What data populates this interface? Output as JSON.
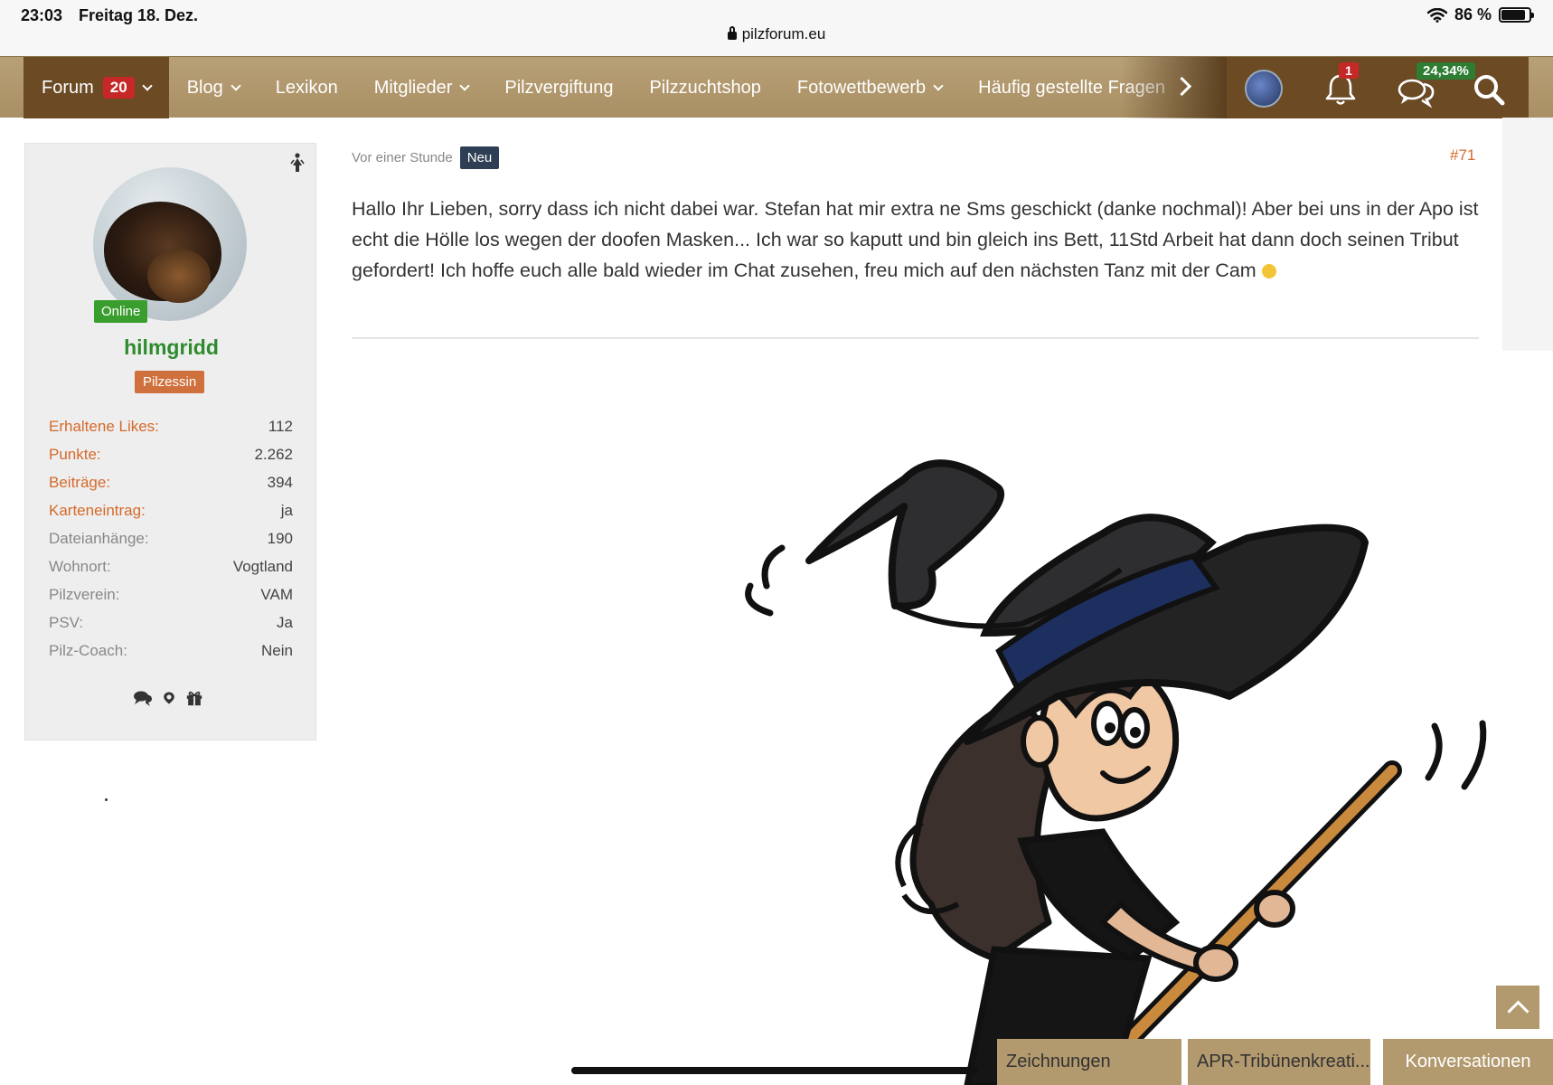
{
  "status": {
    "time": "23:03",
    "date": "Freitag 18. Dez.",
    "battery": "86 %",
    "battery_level": 0.86
  },
  "browser": {
    "url": "pilzforum.eu"
  },
  "nav": {
    "items": [
      {
        "label": "Forum",
        "badge": "20",
        "dropdown": true
      },
      {
        "label": "Blog",
        "dropdown": true
      },
      {
        "label": "Lexikon",
        "dropdown": false
      },
      {
        "label": "Mitglieder",
        "dropdown": true
      },
      {
        "label": "Pilzvergiftung",
        "dropdown": false
      },
      {
        "label": "Pilzzuchtshop",
        "dropdown": false
      },
      {
        "label": "Fotowettbewerb",
        "dropdown": true
      },
      {
        "label": "Häufig gestellte Fragen",
        "dropdown": false
      }
    ],
    "notifications_badge": "1",
    "conversations_badge": "24,34%"
  },
  "user": {
    "name": "hilmgridd",
    "online": "Online",
    "rank": "Pilzessin",
    "stats": [
      {
        "key": "Erhaltene Likes",
        "value": "112",
        "link": true
      },
      {
        "key": "Punkte",
        "value": "2.262",
        "link": true
      },
      {
        "key": "Beiträge",
        "value": "394",
        "link": true
      },
      {
        "key": "Karteneintrag",
        "value": "ja",
        "link": true
      },
      {
        "key": "Dateianhänge",
        "value": "190",
        "link": false
      },
      {
        "key": "Wohnort",
        "value": "Vogtland",
        "link": false
      },
      {
        "key": "Pilzverein",
        "value": "VAM",
        "link": false
      },
      {
        "key": "PSV",
        "value": "Ja",
        "link": false
      },
      {
        "key": "Pilz-Coach",
        "value": "Nein",
        "link": false
      }
    ]
  },
  "post": {
    "time": "Vor einer Stunde",
    "new_label": "Neu",
    "number": "#71",
    "text": "Hallo Ihr Lieben, sorry dass ich nicht dabei war. Stefan hat mir extra ne Sms geschickt (danke nochmal)! Aber bei uns in der Apo ist echt die Hölle los wegen der doofen Masken... Ich war so kaputt und bin gleich ins Bett, 11Std Arbeit hat dann doch seinen Tribut gefordert! Ich hoffe euch alle bald wieder im Chat zusehen, freu mich auf den nächsten Tanz mit der Cam"
  },
  "bottom_tabs": [
    "Zeichnungen",
    "APR-Tribünenkreati...",
    "Konversationen"
  ],
  "colors": {
    "nav": "#a98f63",
    "nav_dark": "#6b4a24",
    "accent": "#d46a2a",
    "online": "#3a9e2e",
    "username": "#2e8b2e"
  }
}
